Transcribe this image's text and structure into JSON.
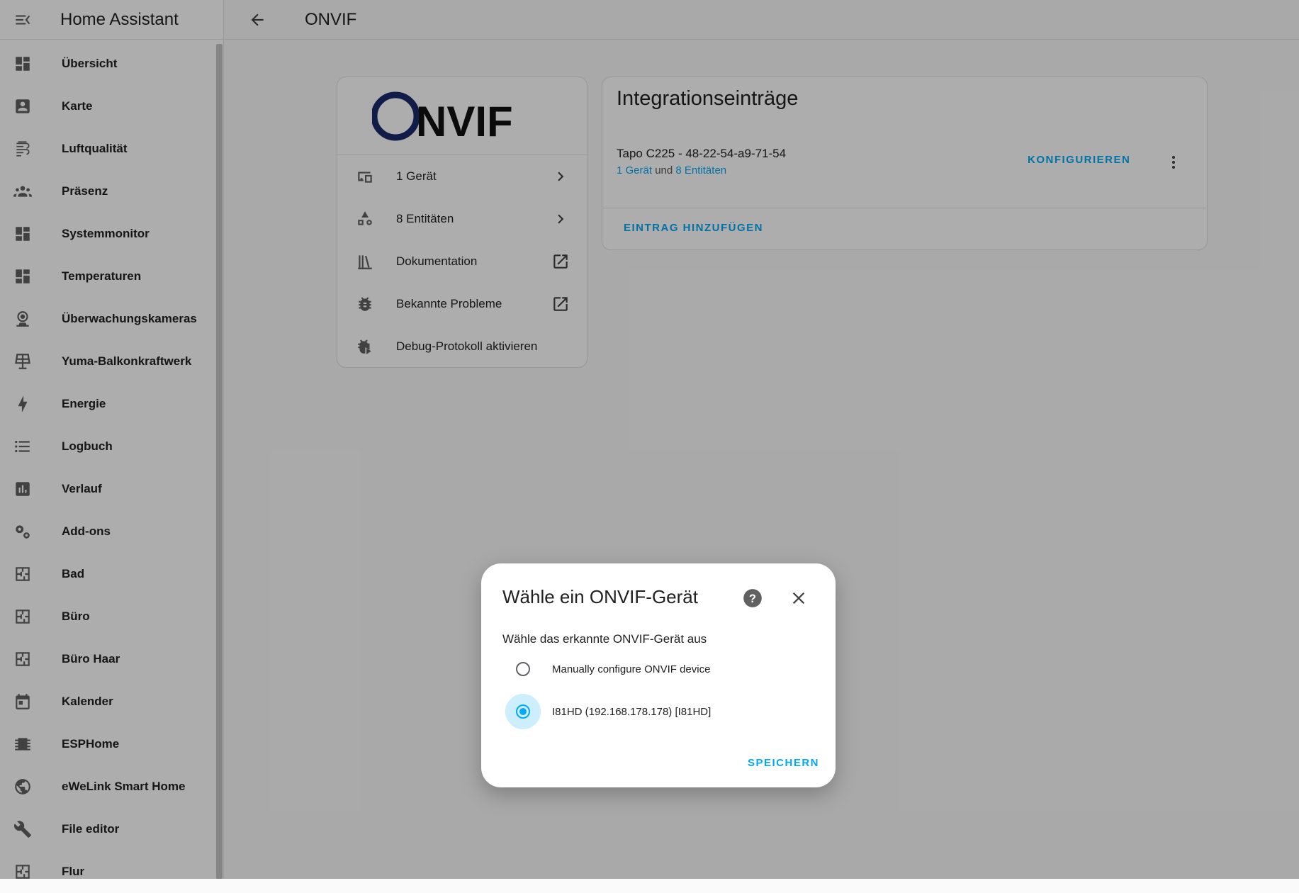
{
  "app": {
    "title": "Home Assistant",
    "accent_color": "#03a9f4",
    "menu_icon": "menu-open-icon"
  },
  "sidebar": {
    "items": [
      {
        "label": "Übersicht",
        "icon": "dashboard-icon"
      },
      {
        "label": "Karte",
        "icon": "map-account-icon"
      },
      {
        "label": "Luftqualität",
        "icon": "air-quality-icon"
      },
      {
        "label": "Präsenz",
        "icon": "account-group-icon"
      },
      {
        "label": "Systemmonitor",
        "icon": "dashboard-icon"
      },
      {
        "label": "Temperaturen",
        "icon": "dashboard-icon"
      },
      {
        "label": "Überwachungskameras",
        "icon": "webcam-icon"
      },
      {
        "label": "Yuma-Balkonkraftwerk",
        "icon": "solar-panel-icon"
      },
      {
        "label": "Energie",
        "icon": "lightning-bolt-icon"
      },
      {
        "label": "Logbuch",
        "icon": "format-list-bulleted-icon"
      },
      {
        "label": "Verlauf",
        "icon": "chart-box-icon"
      },
      {
        "label": "Add-ons",
        "icon": "cogs-icon"
      },
      {
        "label": "Bad",
        "icon": "floor-plan-icon"
      },
      {
        "label": "Büro",
        "icon": "floor-plan-icon"
      },
      {
        "label": "Büro Haar",
        "icon": "floor-plan-icon"
      },
      {
        "label": "Kalender",
        "icon": "calendar-icon"
      },
      {
        "label": "ESPHome",
        "icon": "chip-icon"
      },
      {
        "label": "eWeLink Smart Home",
        "icon": "earth-icon"
      },
      {
        "label": "File editor",
        "icon": "wrench-icon"
      },
      {
        "label": "Flur",
        "icon": "floor-plan-icon"
      }
    ]
  },
  "topbar": {
    "title": "ONVIF",
    "back_icon": "arrow-left-icon"
  },
  "brand_card": {
    "logo_text": "ONVIF",
    "rows": [
      {
        "label": "1 Gerät",
        "icon": "devices-icon",
        "trail": "chevron-right-icon"
      },
      {
        "label": "8 Entitäten",
        "icon": "shape-icon",
        "trail": "chevron-right-icon"
      },
      {
        "label": "Dokumentation",
        "icon": "bookshelf-icon",
        "trail": "open-in-new-icon"
      },
      {
        "label": "Bekannte Probleme",
        "icon": "bug-icon",
        "trail": "open-in-new-icon"
      },
      {
        "label": "Debug-Protokoll aktivieren",
        "icon": "bug-play-icon",
        "trail": ""
      }
    ]
  },
  "entries_card": {
    "title": "Integrationseinträge",
    "entry": {
      "name": "Tapo C225 - 48-22-54-a9-71-54",
      "link_device": "1 Gerät",
      "link_conjunction": "und",
      "link_entities": "8 Entitäten",
      "configure_label": "KONFIGURIEREN"
    },
    "add_entry_label": "EINTRAG HINZUFÜGEN"
  },
  "dialog": {
    "title": "Wähle ein ONVIF-Gerät",
    "description": "Wähle das erkannte ONVIF-Gerät aus",
    "options": [
      {
        "label": "Manually configure ONVIF device",
        "selected": false
      },
      {
        "label": "I81HD (192.168.178.178) [I81HD]",
        "selected": true
      }
    ],
    "save_label": "SPEICHERN"
  }
}
